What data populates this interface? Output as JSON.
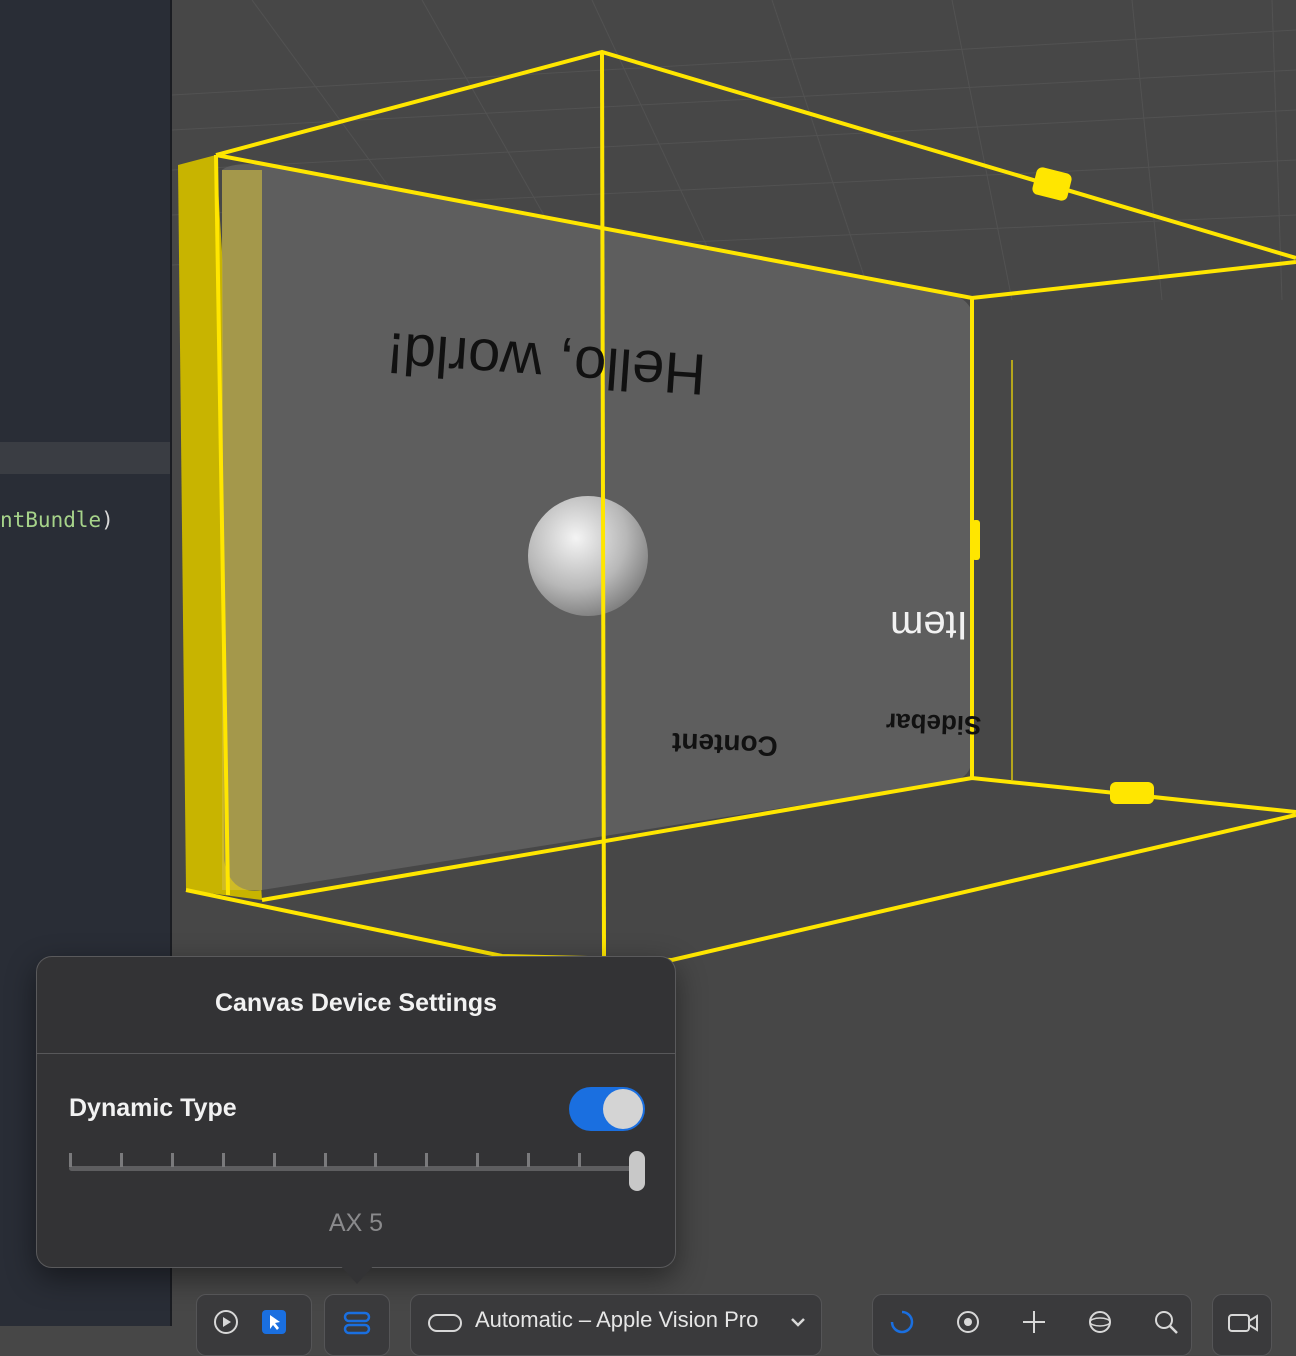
{
  "editor": {
    "code_fragment": "ntBundle",
    "code_suffix": ")"
  },
  "scene": {
    "text_hello": "Hello, world!",
    "text_item": "Item",
    "text_content": "Content",
    "text_sidebar": "Sidebar",
    "colors": {
      "bounding_box": "#ffe600",
      "window_panel": "#5e5e5e",
      "background": "#474747"
    }
  },
  "popover": {
    "title": "Canvas Device Settings",
    "dynamic_type_label": "Dynamic Type",
    "dynamic_type_enabled": true,
    "slider_steps": 12,
    "slider_value_index": 11,
    "slider_value_label": "AX 5"
  },
  "toolbar": {
    "device_selector_label": "Automatic – Apple Vision Pro",
    "accent_color": "#1a6fe0",
    "icons": [
      "play-icon",
      "select-icon",
      "device-settings-icon",
      "vision-pro-icon",
      "chevron-down-icon",
      "rotate-icon",
      "orbit-icon",
      "move-icon",
      "globe-icon",
      "zoom-icon",
      "camera-icon"
    ]
  }
}
